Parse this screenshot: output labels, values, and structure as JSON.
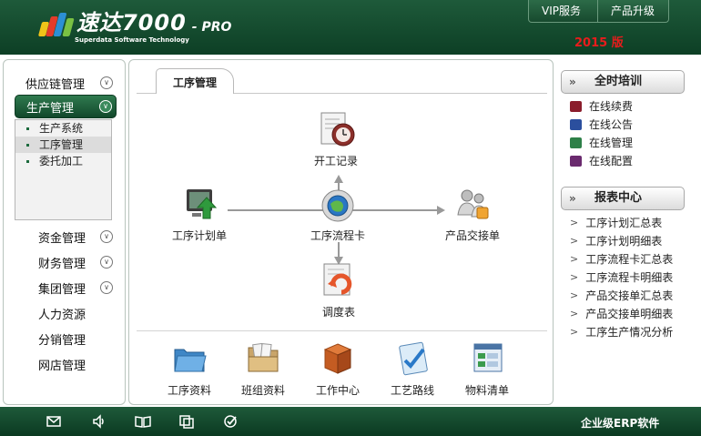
{
  "header": {
    "logo_text": "速达7000",
    "logo_pro": "- PRO",
    "logo_sub": "Superdata Software Technology",
    "tabs": [
      "VIP服务",
      "产品升级"
    ],
    "version": "2015 版",
    "brand_colors": {
      "header_green": "#0d3f25",
      "version_red": "#e81c1c"
    }
  },
  "leftnav": {
    "items": [
      {
        "label": "供应链管理",
        "has_chevron": true
      },
      {
        "label": "生产管理",
        "has_chevron": true,
        "active": true
      },
      {
        "label": "资金管理",
        "has_chevron": true
      },
      {
        "label": "财务管理",
        "has_chevron": true
      },
      {
        "label": "集团管理",
        "has_chevron": true
      },
      {
        "label": "人力资源",
        "has_chevron": false
      },
      {
        "label": "分销管理",
        "has_chevron": false
      },
      {
        "label": "网店管理",
        "has_chevron": false
      }
    ],
    "subitems": [
      {
        "label": "生产系统"
      },
      {
        "label": "工序管理",
        "selected": true
      },
      {
        "label": "委托加工"
      }
    ]
  },
  "main": {
    "tab_label": "工序管理",
    "flow": {
      "start": "开工记录",
      "plan": "工序计划单",
      "card": "工序流程卡",
      "handover": "产品交接单",
      "adjust": "调度表"
    },
    "bottom": [
      "工序资料",
      "班组资料",
      "工作中心",
      "工艺路线",
      "物料清单"
    ]
  },
  "rightpanel": {
    "training": {
      "title": "全时培训",
      "links": [
        {
          "label": "在线续费",
          "icon": "renew-icon"
        },
        {
          "label": "在线公告",
          "icon": "notice-icon"
        },
        {
          "label": "在线管理",
          "icon": "manage-icon"
        },
        {
          "label": "在线配置",
          "icon": "config-icon"
        }
      ]
    },
    "reports": {
      "title": "报表中心",
      "links": [
        "工序计划汇总表",
        "工序计划明细表",
        "工序流程卡汇总表",
        "工序流程卡明细表",
        "产品交接单汇总表",
        "产品交接单明细表",
        "工序生产情况分析"
      ]
    }
  },
  "footer": {
    "icons": [
      "mail-icon",
      "speaker-icon",
      "book-icon",
      "copy-icon",
      "check-icon"
    ],
    "text": "企业级ERP软件"
  }
}
